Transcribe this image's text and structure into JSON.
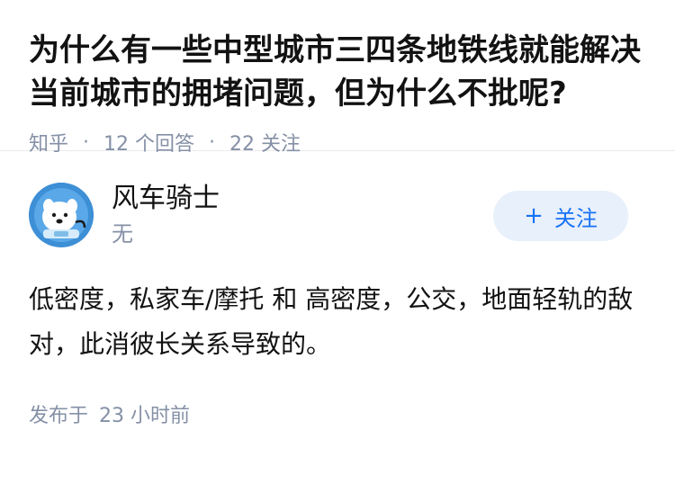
{
  "question": {
    "title": "为什么有一些中型城市三四条地铁线就能解决当前城市的拥堵问题，但为什么不批呢?",
    "source": "知乎",
    "answers": "12 个回答",
    "followers": "22 关注"
  },
  "answer": {
    "author_name": "风车骑士",
    "author_bio": "无",
    "follow_plus": "+",
    "follow_label": "关注",
    "content": "低密度，私家车/摩托 和 高密度，公交，地面轻轨的敌对，此消彼长关系导致的。",
    "posted_label": "发布于",
    "posted_time": "23 小时前"
  },
  "colors": {
    "accent": "#1772f6",
    "button_bg": "#e8f0fb",
    "meta": "#8590a6",
    "text": "#121212",
    "avatar_bg": "#3d8fd6"
  },
  "icons": {
    "avatar": "astronaut-dog-avatar"
  }
}
